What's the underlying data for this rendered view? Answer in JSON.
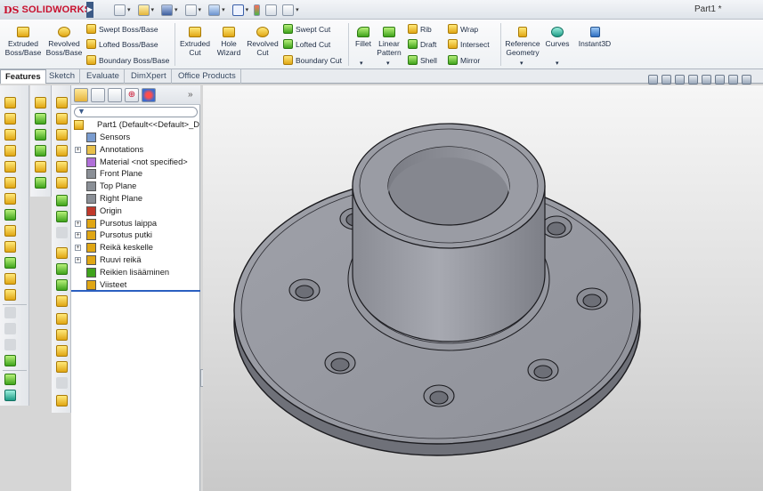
{
  "app": {
    "brand_prefix": "DS",
    "brand": "SOLIDWORKS",
    "document_title": "Part1 *"
  },
  "ribbon": {
    "extruded_boss": "Extruded Boss/Base",
    "revolved_boss": "Revolved Boss/Base",
    "swept_boss": "Swept Boss/Base",
    "lofted_boss": "Lofted Boss/Base",
    "boundary_boss": "Boundary Boss/Base",
    "extruded_cut": "Extruded Cut",
    "hole_wizard": "Hole Wizard",
    "revolved_cut": "Revolved Cut",
    "swept_cut": "Swept Cut",
    "lofted_cut": "Lofted Cut",
    "boundary_cut": "Boundary Cut",
    "fillet": "Fillet",
    "linear_pattern": "Linear Pattern",
    "rib": "Rib",
    "draft": "Draft",
    "shell": "Shell",
    "wrap": "Wrap",
    "intersect": "Intersect",
    "mirror": "Mirror",
    "reference_geometry": "Reference Geometry",
    "curves": "Curves",
    "instant3d": "Instant3D"
  },
  "tabs": [
    "Features",
    "Sketch",
    "Evaluate",
    "DimXpert",
    "Office Products"
  ],
  "tree": {
    "root": "Part1  (Default<<Default>_D",
    "items": [
      "Sensors",
      "Annotations",
      "Material <not specified>",
      "Front Plane",
      "Top Plane",
      "Right Plane",
      "Origin",
      "Pursotus laippa",
      "Pursotus putki",
      "Reikä keskelle",
      "Ruuvi reikä",
      "Reikien lisääminen",
      "Viisteet"
    ]
  },
  "colors": {
    "accent": "#2a5fc0",
    "brand": "#c8102e",
    "part": "#9a9ca4"
  }
}
